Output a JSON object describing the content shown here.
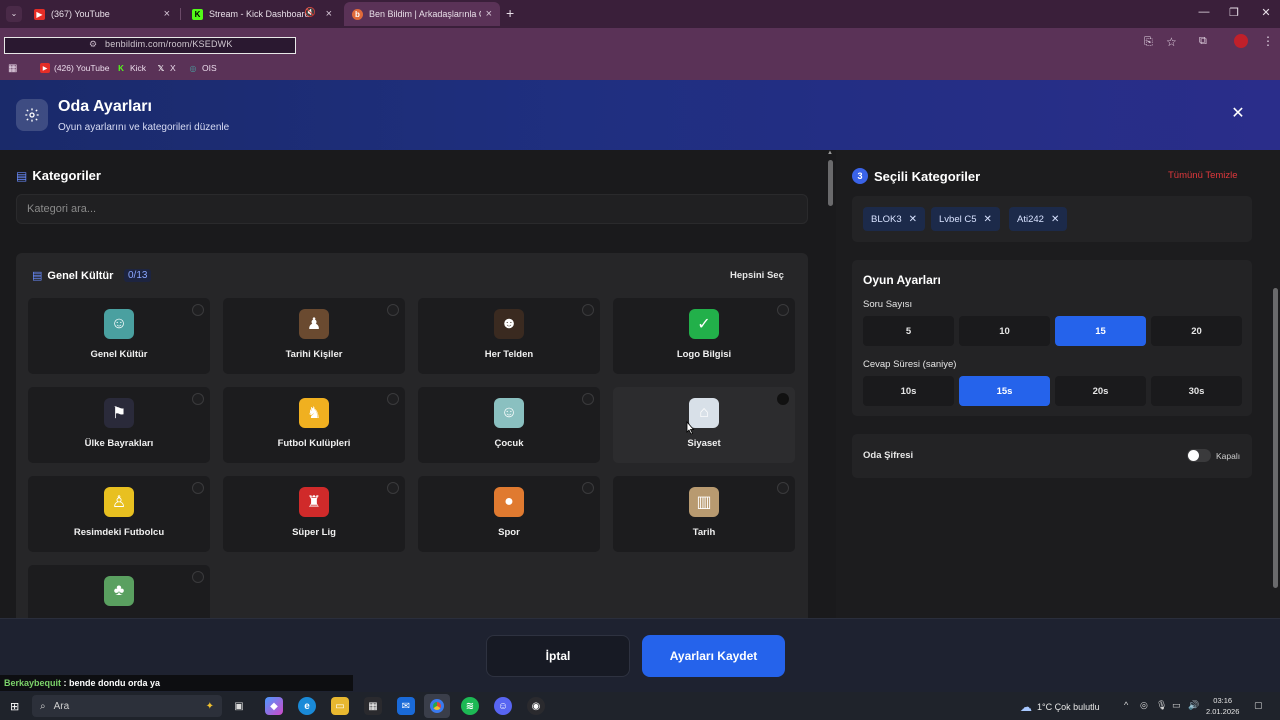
{
  "browser": {
    "tabs": [
      {
        "title": "(367) YouTube",
        "active": false
      },
      {
        "title": "Stream - Kick Dashboard",
        "active": false
      },
      {
        "title": "Ben Bildim | Arkadaşlarınla Onl",
        "active": true
      }
    ],
    "new_tab": "+",
    "url": "benbildim.com/room/KSEDWK",
    "bookmarks": [
      "(426) YouTube",
      "Kick",
      "X",
      "OIS"
    ]
  },
  "modal": {
    "title": "Oda Ayarları",
    "subtitle": "Oyun ayarlarını ve kategorileri düzenle"
  },
  "categories": {
    "heading": "Kategoriler",
    "search_placeholder": "Kategori ara...",
    "group": {
      "name": "Genel Kültür",
      "count": "0/13",
      "select_all": "Hepsini Seç",
      "items": [
        {
          "label": "Genel Kültür",
          "icon": "brain-icon",
          "color": "#4aa0a0"
        },
        {
          "label": "Tarihi Kişiler",
          "icon": "portrait-icon",
          "color": "#6a4a30"
        },
        {
          "label": "Her Telden",
          "icon": "sunglasses-icon",
          "color": "#3a2a20"
        },
        {
          "label": "Logo Bilgisi",
          "icon": "logo-icon",
          "color": "#22b04a"
        },
        {
          "label": "Ülke Bayrakları",
          "icon": "flag-icon",
          "color": "#2a2a3a"
        },
        {
          "label": "Futbol Kulüpleri",
          "icon": "wolf-crest-icon",
          "color": "#f0b020"
        },
        {
          "label": "Çocuk",
          "icon": "child-icon",
          "color": "#8ac0c0"
        },
        {
          "label": "Siyaset",
          "icon": "parliament-icon",
          "color": "#d8e0e8"
        },
        {
          "label": "Resimdeki Futbolcu",
          "icon": "player-icon",
          "color": "#e8c020"
        },
        {
          "label": "Süper Lig",
          "icon": "club-crest-icon",
          "color": "#d02a2a"
        },
        {
          "label": "Spor",
          "icon": "balls-icon",
          "color": "#e07a30"
        },
        {
          "label": "Tarih",
          "icon": "colosseum-icon",
          "color": "#b89a70"
        },
        {
          "label": "",
          "icon": "island-icon",
          "color": "#5aa060"
        }
      ]
    }
  },
  "selected": {
    "count": "3",
    "heading": "Seçili Kategoriler",
    "clear_all": "Tümünü Temizle",
    "chips": [
      "BLOK3",
      "Lvbel C5",
      "Ati242"
    ]
  },
  "game_settings": {
    "title": "Oyun Ayarları",
    "question_count_label": "Soru Sayısı",
    "question_counts": [
      "5",
      "10",
      "15",
      "20"
    ],
    "question_count_selected": "15",
    "answer_time_label": "Cevap Süresi (saniye)",
    "answer_times": [
      "10s",
      "15s",
      "20s",
      "30s"
    ],
    "answer_time_selected": "15s"
  },
  "room_password": {
    "label": "Oda Şifresi",
    "state": "Kapalı"
  },
  "footer": {
    "cancel": "İptal",
    "save": "Ayarları Kaydet"
  },
  "chat": {
    "user": "Berkaybequit",
    "message": ": bende dondu orda ya"
  },
  "taskbar": {
    "search": "Ara",
    "weather": "1°C  Çok bulutlu",
    "time": "03:16",
    "date": "2.01.2026"
  },
  "colors": {
    "accent": "#2563eb",
    "danger": "#e0383c",
    "header_start": "#1a2a6a",
    "header_end": "#2a2d8a"
  }
}
